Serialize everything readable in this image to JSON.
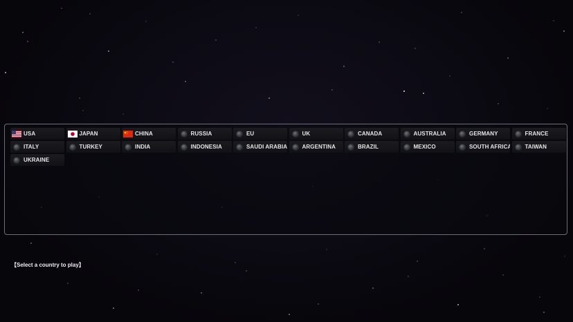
{
  "countries": [
    {
      "name": "USA",
      "flag": "usa-flag"
    },
    {
      "name": "JAPAN",
      "flag": "japan-flag"
    },
    {
      "name": "CHINA",
      "flag": "china-flag"
    },
    {
      "name": "RUSSIA",
      "flag": null
    },
    {
      "name": "EU",
      "flag": null
    },
    {
      "name": "UK",
      "flag": null
    },
    {
      "name": "CANADA",
      "flag": null
    },
    {
      "name": "AUSTRALIA",
      "flag": null
    },
    {
      "name": "GERMANY",
      "flag": null
    },
    {
      "name": "FRANCE",
      "flag": null
    },
    {
      "name": "ITALY",
      "flag": null
    },
    {
      "name": "TURKEY",
      "flag": null
    },
    {
      "name": "INDIA",
      "flag": null
    },
    {
      "name": "INDONESIA",
      "flag": null
    },
    {
      "name": "SAUDI ARABIA",
      "flag": null
    },
    {
      "name": "ARGENTINA",
      "flag": null
    },
    {
      "name": "BRAZIL",
      "flag": null
    },
    {
      "name": "MEXICO",
      "flag": null
    },
    {
      "name": "SOUTH AFRICA",
      "flag": null
    },
    {
      "name": "TAIWAN",
      "flag": null
    },
    {
      "name": "UKRAINE",
      "flag": null
    }
  ],
  "status": {
    "prompt": "【Select a country to play】"
  },
  "colors": {
    "background": "#07060b",
    "panel_border": "#6b6f78",
    "text": "#e6e6e8"
  }
}
